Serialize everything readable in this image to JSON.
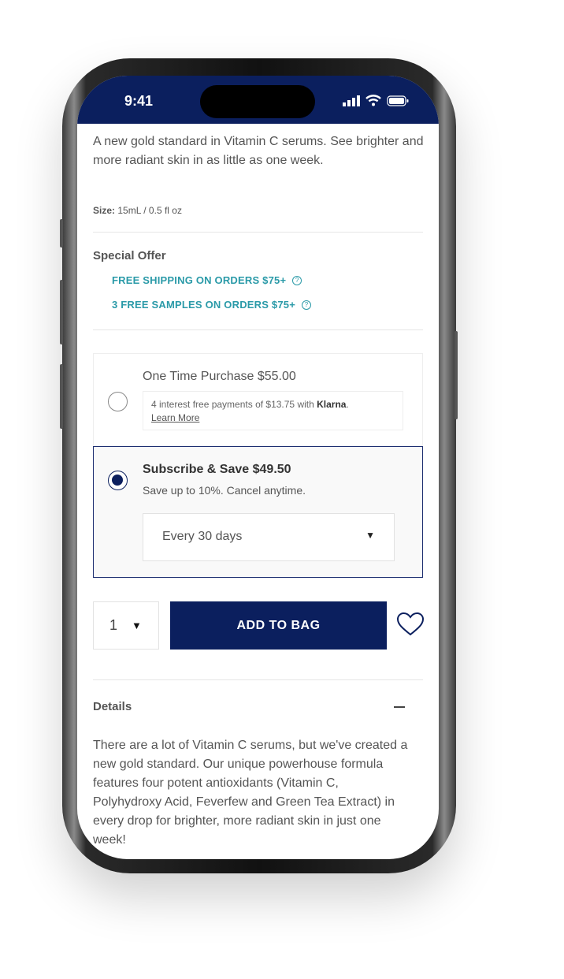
{
  "status_bar": {
    "time": "9:41"
  },
  "product": {
    "description": "A new gold standard in Vitamin C serums. See brighter and more radiant skin in as little as one week.",
    "size_label": "Size:",
    "size_value": "15mL / 0.5 fl oz"
  },
  "special_offer": {
    "title": "Special Offer",
    "offers": [
      {
        "label": "FREE SHIPPING ON ORDERS $75+",
        "icon": "question-circle-icon"
      },
      {
        "label": "3 FREE SAMPLES ON ORDERS $75+",
        "icon": "question-circle-icon"
      }
    ]
  },
  "purchase_options": {
    "one_time": {
      "title": "One Time Purchase $55.00",
      "selected": false,
      "klarna_text": "4 interest free payments of $13.75 with ",
      "klarna_brand": "Klarna",
      "klarna_period": ".",
      "learn_more": "Learn More"
    },
    "subscribe": {
      "title": "Subscribe & Save $49.50",
      "selected": true,
      "subtitle": "Save up to 10%. Cancel anytime.",
      "frequency": "Every 30 days"
    }
  },
  "cart": {
    "quantity": "1",
    "add_to_bag": "ADD TO BAG"
  },
  "details": {
    "title": "Details",
    "body": "There are a lot of Vitamin C serums, but we've created a new gold standard. Our unique powerhouse formula features four potent antioxidants (Vitamin C, Polyhydroxy Acid, Feverfew and Green Tea Extract) in every drop for brighter, more radiant skin in just one week!"
  },
  "colors": {
    "brand_navy": "#0b1f5e",
    "offer_teal": "#2a9aa8"
  }
}
